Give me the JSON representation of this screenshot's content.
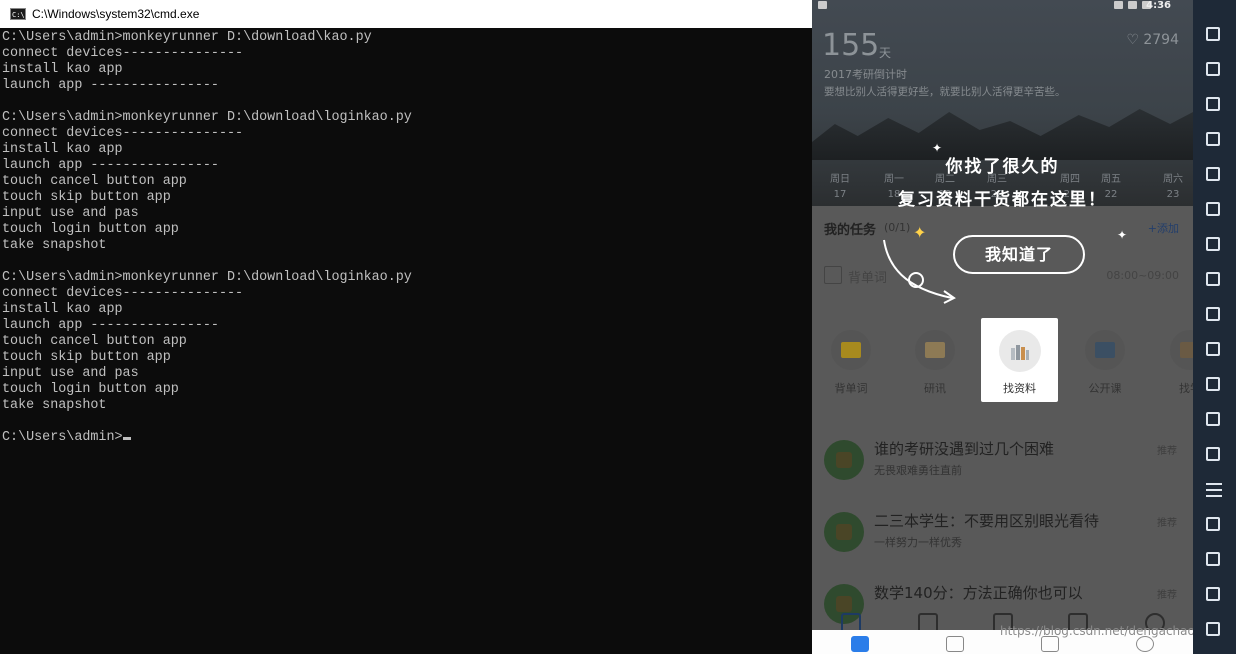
{
  "cmd": {
    "title": "C:\\Windows\\system32\\cmd.exe",
    "icon": "cmd-icon",
    "lines": [
      "C:\\Users\\admin>monkeyrunner D:\\download\\kao.py",
      "connect devices---------------",
      "install kao app",
      "launch app ----------------",
      "",
      "C:\\Users\\admin>monkeyrunner D:\\download\\loginkao.py",
      "connect devices---------------",
      "install kao app",
      "launch app ----------------",
      "touch cancel button app",
      "touch skip button app",
      "input use and pas",
      "touch login button app",
      "take snapshot",
      "",
      "C:\\Users\\admin>monkeyrunner D:\\download\\loginkao.py",
      "connect devices---------------",
      "install kao app",
      "launch app ----------------",
      "touch cancel button app",
      "touch skip button app",
      "input use and pas",
      "touch login button app",
      "take snapshot",
      "",
      "C:\\Users\\admin>"
    ]
  },
  "phone": {
    "status_time": "4:36",
    "days": "155",
    "days_unit": "天",
    "likes": "2794",
    "heart_icon": "♡",
    "countdown_title": "2017考研倒计时",
    "countdown_motto": "要想比别人活得更好些，就要比别人活得更辛苦些。",
    "weekdays": [
      {
        "day": "周日",
        "date": "17"
      },
      {
        "day": "周一",
        "date": "18"
      },
      {
        "day": "周二",
        "date": "19"
      },
      {
        "day": "周三",
        "date": "20"
      },
      {
        "day": "周四",
        "date": "21"
      },
      {
        "day": "周五",
        "date": "22"
      },
      {
        "day": "周六",
        "date": "23"
      }
    ],
    "tasks": {
      "header": "我的任务",
      "count": "(0/1)",
      "add": "+添加",
      "task_name": "背单词",
      "task_time": "08:00~09:00"
    },
    "features": [
      {
        "label": "背单词",
        "color": "#a88a1e"
      },
      {
        "label": "研讯",
        "color": "#8d7a55"
      },
      {
        "label": "找资料",
        "color": "#9aa2a8"
      },
      {
        "label": "公开课",
        "color": "#3b4f63"
      },
      {
        "label": "找学",
        "color": "#6a5a44"
      }
    ],
    "recommendations": [
      {
        "title": "谁的考研没遇到过几个困难",
        "sub": "无畏艰难勇往直前",
        "tag": "推荐"
      },
      {
        "title": "二三本学生：不要用区别眼光看待",
        "sub": "一样努力一样优秀",
        "tag": "推荐"
      },
      {
        "title": "数学140分：方法正确你也可以",
        "sub": "",
        "tag": "推荐"
      }
    ],
    "guide": {
      "line1": "你找了很久的",
      "line2": "复习资料干货都在这里！",
      "button": "我知道了",
      "highlight_label": "找资料"
    },
    "watermark": "https://blog.csdn.net/dengachao"
  },
  "toolbar": {
    "icons": [
      "phone-shake-icon",
      "robot-icon",
      "location-icon",
      "screen-icon",
      "install-apk-icon",
      "fullscreen-icon",
      "volume-up-icon",
      "volume-down-icon",
      "keyboard-icon",
      "screenshot-area-icon",
      "apk-icon",
      "scissors-icon",
      "multi-window-icon",
      "menu-icon",
      "resize-icon",
      "back-icon",
      "home-icon",
      "recent-apps-icon"
    ]
  }
}
